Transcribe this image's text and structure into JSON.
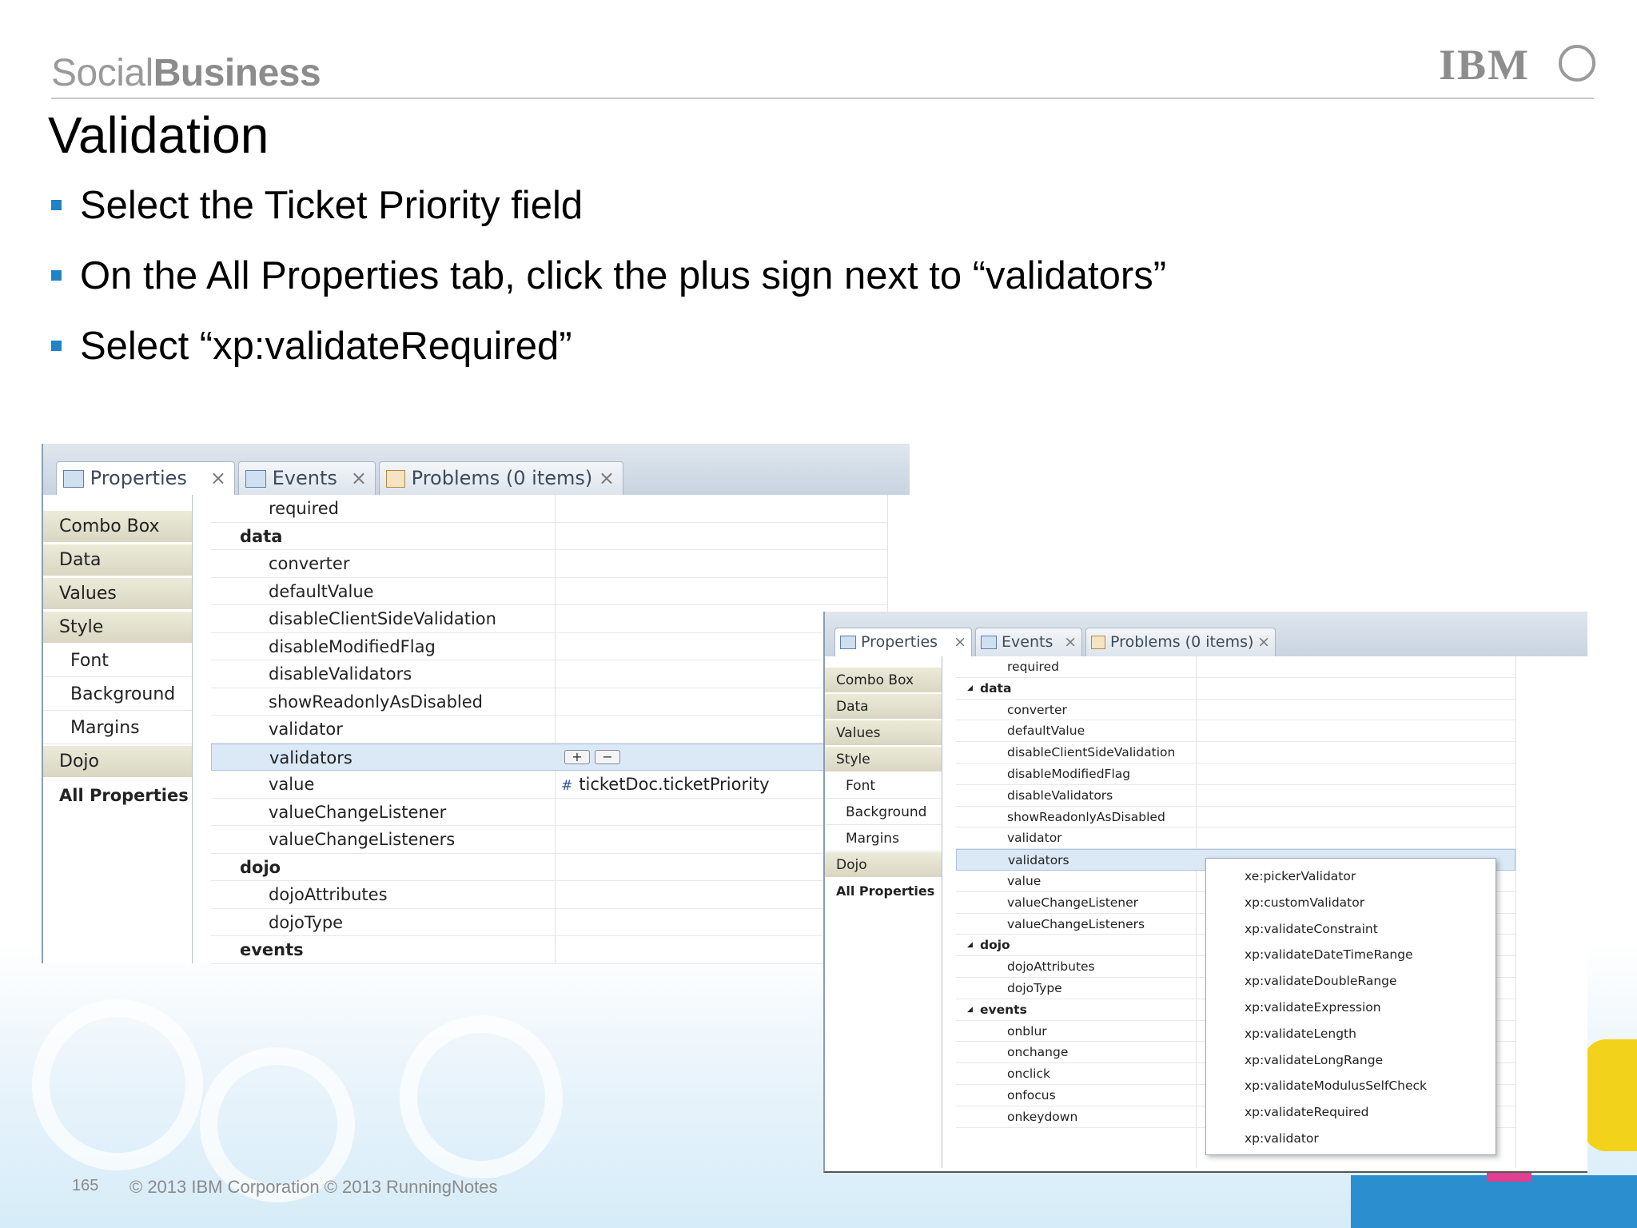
{
  "header": {
    "brand_light": "Social",
    "brand_bold": "Business",
    "logo_text": "IBM"
  },
  "slide": {
    "title": "Validation",
    "bullets": [
      "Select the Ticket Priority field",
      "On the All Properties tab, click the plus sign next to “validators”",
      "Select “xp:validateRequired”"
    ]
  },
  "left_panel": {
    "tabs": [
      {
        "label": "Properties",
        "close": "×"
      },
      {
        "label": "Events",
        "close": "×"
      },
      {
        "label": "Problems (0 items)",
        "close": "×"
      }
    ],
    "sidebar": [
      "Combo Box",
      "Data",
      "Values",
      "Style",
      "Font",
      "Background",
      "Margins",
      "Dojo",
      "All Properties"
    ],
    "rows": [
      {
        "label": "required",
        "group": false
      },
      {
        "label": "data",
        "group": true
      },
      {
        "label": "converter",
        "group": false
      },
      {
        "label": "defaultValue",
        "group": false
      },
      {
        "label": "disableClientSideValidation",
        "group": false
      },
      {
        "label": "disableModifiedFlag",
        "group": false
      },
      {
        "label": "disableValidators",
        "group": false
      },
      {
        "label": "showReadonlyAsDisabled",
        "group": false
      },
      {
        "label": "validator",
        "group": false
      },
      {
        "label": "validators",
        "group": false
      },
      {
        "label": "value",
        "group": false
      },
      {
        "label": "valueChangeListener",
        "group": false
      },
      {
        "label": "valueChangeListeners",
        "group": false
      },
      {
        "label": "dojo",
        "group": true
      },
      {
        "label": "dojoAttributes",
        "group": false
      },
      {
        "label": "dojoType",
        "group": false
      },
      {
        "label": "events",
        "group": true
      }
    ],
    "value_binding": "ticketDoc.ticketPriority",
    "add_button": "+",
    "remove_button": "−"
  },
  "right_panel": {
    "tabs": [
      {
        "label": "Properties",
        "close": "×"
      },
      {
        "label": "Events",
        "close": "×"
      },
      {
        "label": "Problems (0 items)",
        "close": "×"
      }
    ],
    "sidebar": [
      "Combo Box",
      "Data",
      "Values",
      "Style",
      "Font",
      "Background",
      "Margins",
      "Dojo",
      "All Properties"
    ],
    "rows": [
      {
        "label": "required",
        "group": false
      },
      {
        "label": "data",
        "group": true
      },
      {
        "label": "converter",
        "group": false
      },
      {
        "label": "defaultValue",
        "group": false
      },
      {
        "label": "disableClientSideValidation",
        "group": false
      },
      {
        "label": "disableModifiedFlag",
        "group": false
      },
      {
        "label": "disableValidators",
        "group": false
      },
      {
        "label": "showReadonlyAsDisabled",
        "group": false
      },
      {
        "label": "validator",
        "group": false
      },
      {
        "label": "validators",
        "group": false
      },
      {
        "label": "value",
        "group": false
      },
      {
        "label": "valueChangeListener",
        "group": false
      },
      {
        "label": "valueChangeListeners",
        "group": false
      },
      {
        "label": "dojo",
        "group": true
      },
      {
        "label": "dojoAttributes",
        "group": false
      },
      {
        "label": "dojoType",
        "group": false
      },
      {
        "label": "events",
        "group": true
      },
      {
        "label": "onblur",
        "group": false
      },
      {
        "label": "onchange",
        "group": false
      },
      {
        "label": "onclick",
        "group": false
      },
      {
        "label": "onfocus",
        "group": false
      },
      {
        "label": "onkeydown",
        "group": false
      }
    ],
    "validator_menu": [
      "xe:pickerValidator",
      "xp:customValidator",
      "xp:validateConstraint",
      "xp:validateDateTimeRange",
      "xp:validateDoubleRange",
      "xp:validateExpression",
      "xp:validateLength",
      "xp:validateLongRange",
      "xp:validateModulusSelfCheck",
      "xp:validateRequired",
      "xp:validator"
    ]
  },
  "footer": {
    "page_number": "165",
    "copyright": "© 2013 IBM Corporation  © 2013 RunningNotes"
  }
}
